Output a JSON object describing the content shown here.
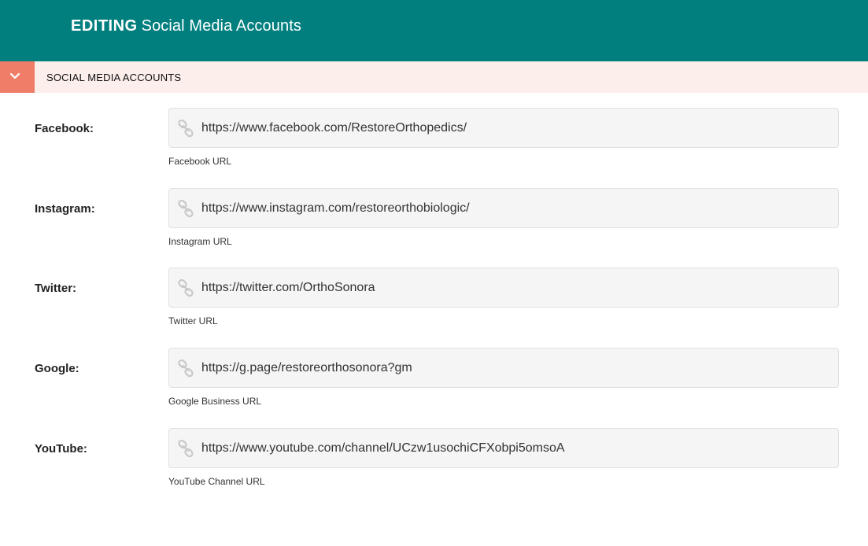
{
  "header": {
    "title_strong": "EDITING",
    "title_rest": "Social Media Accounts"
  },
  "section": {
    "title": "SOCIAL MEDIA ACCOUNTS",
    "toggle_icon": "chevron-down-icon"
  },
  "fields": [
    {
      "label": "Facebook:",
      "value": "https://www.facebook.com/RestoreOrthopedics/",
      "help": "Facebook URL",
      "icon": "link-icon"
    },
    {
      "label": "Instagram:",
      "value": "https://www.instagram.com/restoreorthobiologic/",
      "help": "Instagram URL",
      "icon": "link-icon"
    },
    {
      "label": "Twitter:",
      "value": "https://twitter.com/OrthoSonora",
      "help": "Twitter URL",
      "icon": "link-icon"
    },
    {
      "label": "Google:",
      "value": "https://g.page/restoreorthosonora?gm",
      "help": "Google Business URL",
      "icon": "link-icon"
    },
    {
      "label": "YouTube:",
      "value": "https://www.youtube.com/channel/UCzw1usochiCFXobpi5omsoA",
      "help": "YouTube Channel URL",
      "icon": "link-icon"
    }
  ],
  "colors": {
    "header_bg": "#017f7f",
    "section_bar_bg": "#fbeeeb",
    "toggle_bg": "#ef7d68",
    "input_bg": "#f5f5f5"
  }
}
